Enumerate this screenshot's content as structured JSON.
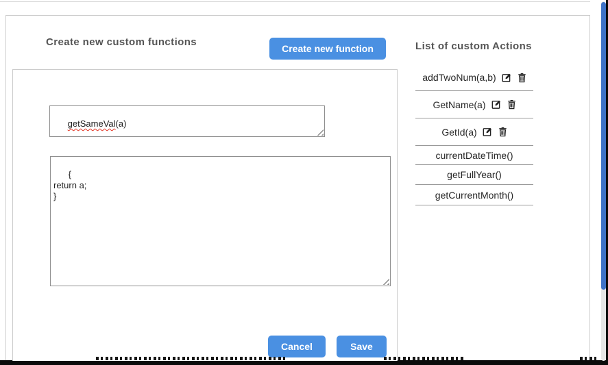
{
  "header": {
    "left_title": "Create new custom functions",
    "create_button_label": "Create new function",
    "right_title": "List of custom Actions"
  },
  "editor": {
    "function_name": {
      "value": "getSameVal(a)",
      "misspelled_part": "getSameVal",
      "rest_part": "(a)"
    },
    "function_body": "{\nreturn a;\n}",
    "cancel_label": "Cancel",
    "save_label": "Save"
  },
  "custom_actions": [
    {
      "label": "addTwoNum(a,b)",
      "has_edit": true,
      "has_delete": true
    },
    {
      "label": "GetName(a)",
      "has_edit": true,
      "has_delete": true
    },
    {
      "label": "GetId(a)",
      "has_edit": true,
      "has_delete": true
    },
    {
      "label": "currentDateTime()",
      "has_edit": false,
      "has_delete": false
    },
    {
      "label": "getFullYear()",
      "has_edit": false,
      "has_delete": false
    },
    {
      "label": "getCurrentMonth()",
      "has_edit": false,
      "has_delete": false
    }
  ],
  "icons": {
    "edit": "edit-icon (pencil on square)",
    "delete": "trash-icon (waste bin)"
  },
  "colors": {
    "accent_blue": "#4a90e2",
    "scrollbar_thumb_blue": "#3f73c8",
    "heading_gray": "#555555",
    "border_gray": "#cccccc",
    "row_divider_gray": "#999999"
  }
}
